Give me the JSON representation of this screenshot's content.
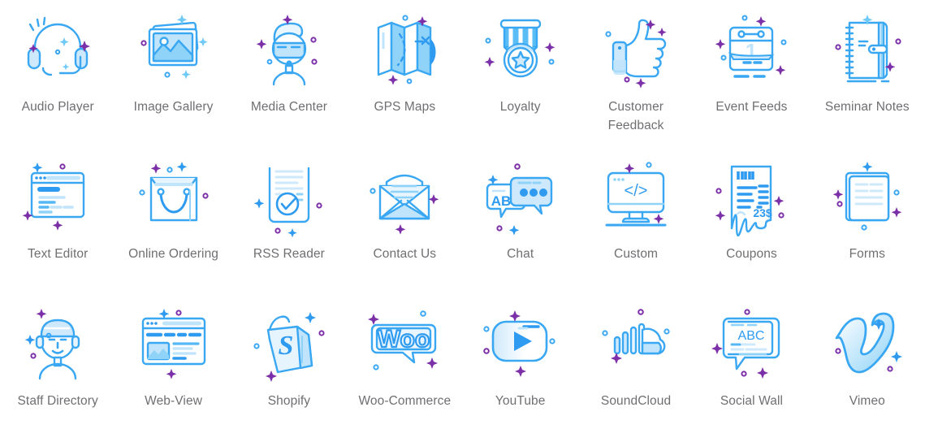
{
  "page": {
    "background_color": "#ffffff",
    "label_color": "#6f6f73",
    "accent_blue_dark": "#2f9bf0",
    "accent_blue_light": "#62c5f7",
    "accent_blue_fill": "#bfe4fb",
    "accent_purple": "#7b2fa8",
    "columns": 8,
    "rows": 3
  },
  "grid": {
    "items": [
      {
        "label": "Audio Player",
        "icon": "headphones-icon"
      },
      {
        "label": "Image Gallery",
        "icon": "photos-icon"
      },
      {
        "label": "Media Center",
        "icon": "vr-person-icon"
      },
      {
        "label": "GPS Maps",
        "icon": "folded-map-icon"
      },
      {
        "label": "Loyalty",
        "icon": "medal-icon"
      },
      {
        "label": "Customer Feedback",
        "icon": "thumbs-up-icon"
      },
      {
        "label": "Event Feeds",
        "icon": "calendar-icon"
      },
      {
        "label": "Seminar Notes",
        "icon": "notebook-icon"
      },
      {
        "label": "Text Editor",
        "icon": "browser-text-icon"
      },
      {
        "label": "Online Ordering",
        "icon": "shopping-bag-icon"
      },
      {
        "label": "RSS Reader",
        "icon": "document-check-icon"
      },
      {
        "label": "Contact Us",
        "icon": "open-envelope-icon"
      },
      {
        "label": "Chat",
        "icon": "speech-bubbles-icon"
      },
      {
        "label": "Custom",
        "icon": "monitor-code-icon"
      },
      {
        "label": "Coupons",
        "icon": "receipt-icon"
      },
      {
        "label": "Forms",
        "icon": "form-pages-icon"
      },
      {
        "label": "Staff Directory",
        "icon": "person-face-icon"
      },
      {
        "label": "Web-View",
        "icon": "browser-layout-icon"
      },
      {
        "label": "Shopify",
        "icon": "shopify-bag-icon"
      },
      {
        "label": "Woo-Commerce",
        "icon": "woo-bubble-icon"
      },
      {
        "label": "YouTube",
        "icon": "youtube-play-icon"
      },
      {
        "label": "SoundCloud",
        "icon": "soundcloud-icon"
      },
      {
        "label": "Social Wall",
        "icon": "abc-bubble-icon"
      },
      {
        "label": "Vimeo",
        "icon": "vimeo-v-icon"
      }
    ]
  },
  "icon_text": {
    "calendar_day": "1",
    "code_glyph": "</>",
    "coupon_amount": "23$",
    "chat_letters": "AB",
    "woo_word": "Woo",
    "social_letters": "ABC"
  }
}
